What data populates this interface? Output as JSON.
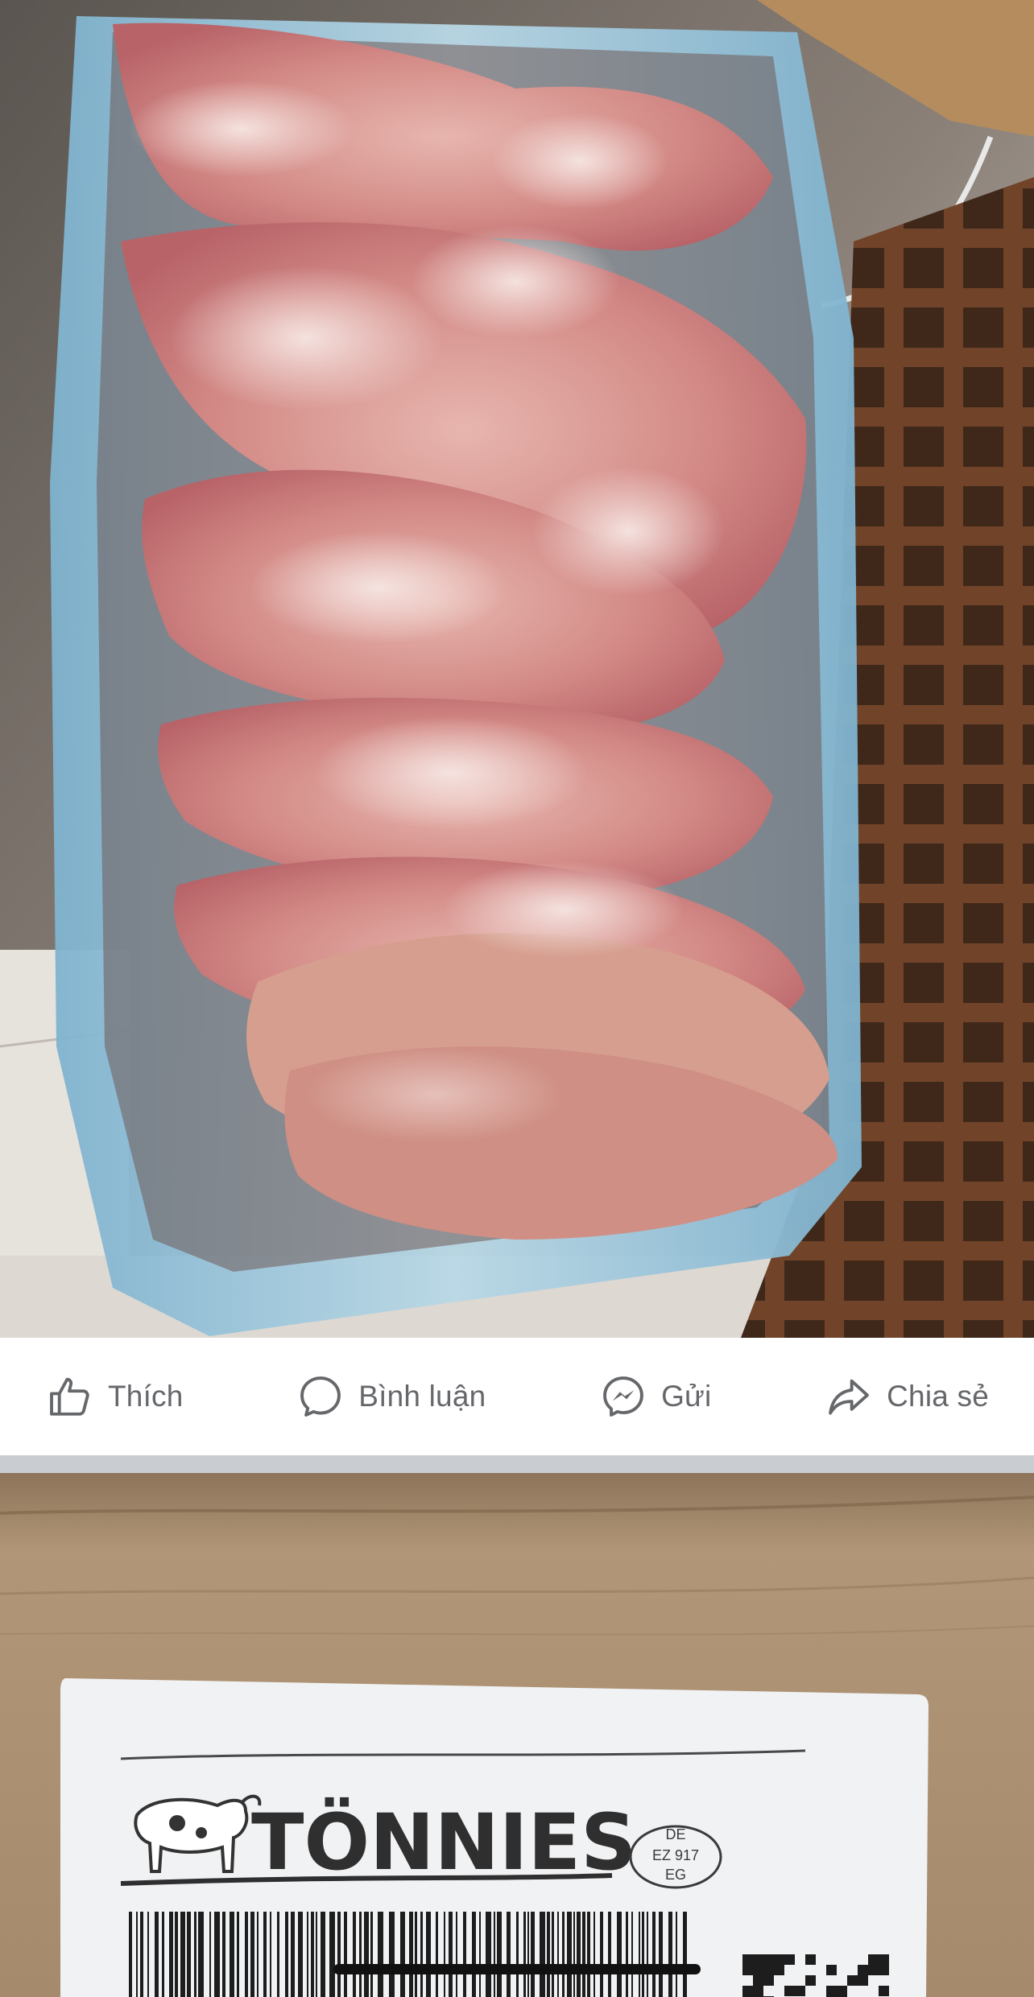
{
  "actions": [
    {
      "label": "Thích",
      "icon": "thumbs-up-icon"
    },
    {
      "label": "Bình luận",
      "icon": "comment-icon"
    },
    {
      "label": "Gửi",
      "icon": "messenger-icon"
    },
    {
      "label": "Chia sẻ",
      "icon": "share-icon"
    }
  ],
  "second_photo": {
    "brand": "TÖNNIES",
    "seal_lines": [
      "DE",
      "EZ 917",
      "EG"
    ]
  },
  "colors": {
    "action_gray": "#65676b",
    "divider": "#c9ccd1",
    "cardboard": "#a38a6c",
    "meat": "#d98d8a",
    "bag": "#9fc6da"
  }
}
